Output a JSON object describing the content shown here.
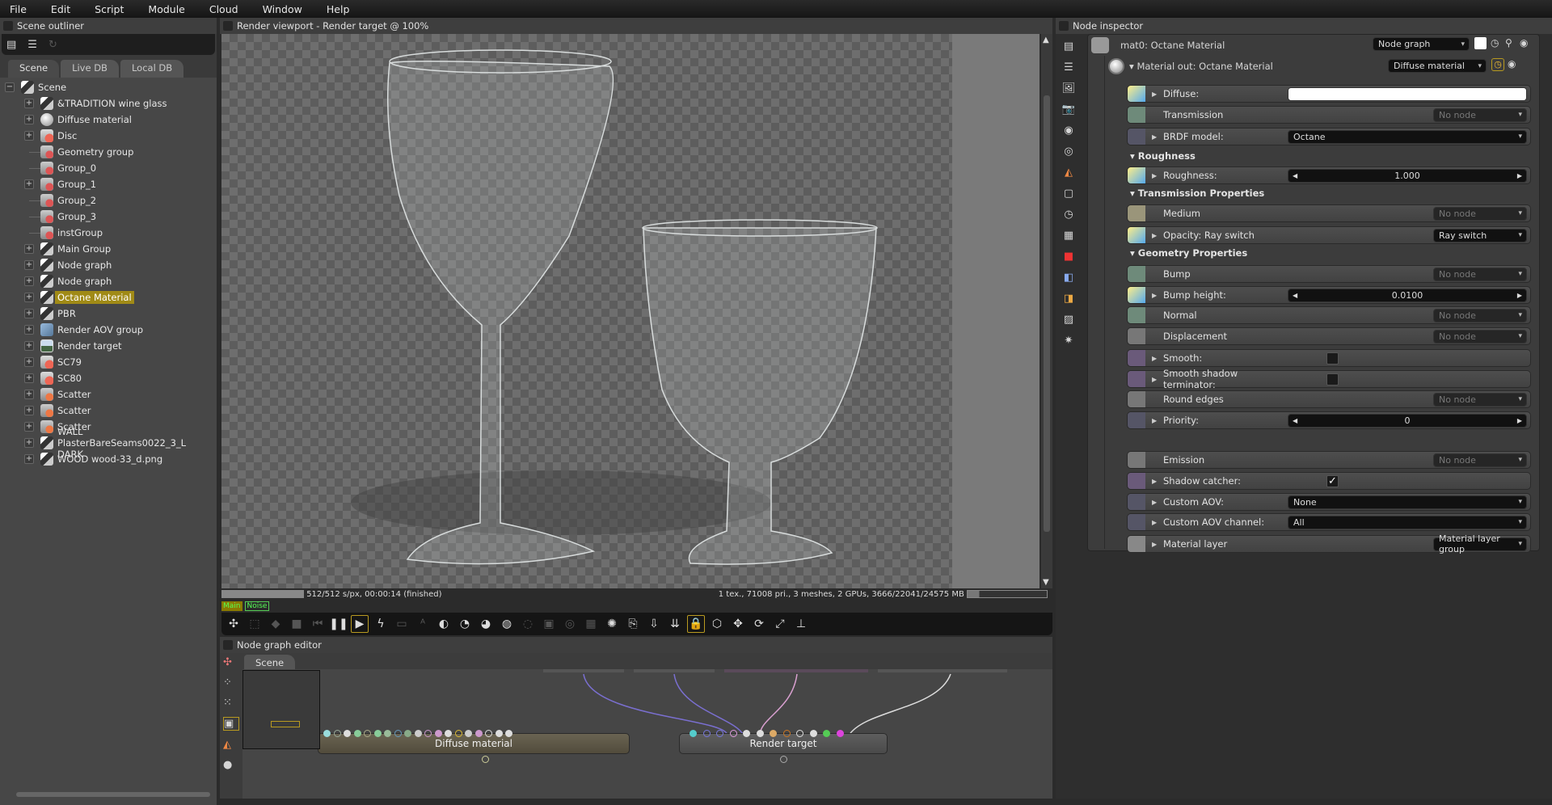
{
  "menu": [
    "File",
    "Edit",
    "Script",
    "Module",
    "Cloud",
    "Window",
    "Help"
  ],
  "outliner": {
    "title": "Scene outliner",
    "tabs": [
      "Scene",
      "Live DB",
      "Local DB"
    ],
    "root": "Scene",
    "items": [
      {
        "label": "&TRADITION wine glass",
        "icon": "node-graph-icon",
        "expandable": true
      },
      {
        "label": "Diffuse material",
        "icon": "material-sphere-icon",
        "expandable": true
      },
      {
        "label": "Disc",
        "icon": "geometry-icon",
        "expandable": true
      },
      {
        "label": "Geometry group",
        "icon": "geometry-group-icon",
        "expandable": false
      },
      {
        "label": "Group_0",
        "icon": "geometry-group-icon",
        "expandable": false
      },
      {
        "label": "Group_1",
        "icon": "geometry-group-icon",
        "expandable": true
      },
      {
        "label": "Group_2",
        "icon": "geometry-group-icon",
        "expandable": false
      },
      {
        "label": "Group_3",
        "icon": "geometry-group-icon",
        "expandable": false
      },
      {
        "label": "instGroup",
        "icon": "geometry-group-icon",
        "expandable": false
      },
      {
        "label": "Main Group",
        "icon": "node-graph-icon",
        "expandable": true
      },
      {
        "label": "Node graph",
        "icon": "node-graph-icon",
        "expandable": true
      },
      {
        "label": "Node graph",
        "icon": "node-graph-icon",
        "expandable": true
      },
      {
        "label": "Octane Material",
        "icon": "node-graph-icon",
        "expandable": true,
        "selected": true
      },
      {
        "label": "PBR",
        "icon": "node-graph-icon",
        "expandable": true
      },
      {
        "label": "Render AOV group",
        "icon": "aov-group-icon",
        "expandable": true
      },
      {
        "label": "Render target",
        "icon": "render-target-icon",
        "expandable": true
      },
      {
        "label": "SC79",
        "icon": "geometry-icon",
        "expandable": true
      },
      {
        "label": "SC80",
        "icon": "geometry-icon",
        "expandable": true
      },
      {
        "label": "Scatter",
        "icon": "scatter-icon",
        "expandable": true
      },
      {
        "label": "Scatter",
        "icon": "scatter-icon",
        "expandable": true
      },
      {
        "label": "Scatter",
        "icon": "scatter-icon",
        "expandable": true
      },
      {
        "label": "WALL PlasterBareSeams0022_3_L DARK",
        "icon": "node-graph-icon",
        "expandable": true
      },
      {
        "label": "WOOD wood-33_d.png",
        "icon": "node-graph-icon",
        "expandable": true
      }
    ]
  },
  "viewport": {
    "title": "Render viewport - Render target @ 100%",
    "status_left": "512/512 s/px, 00:00:14 (finished)",
    "status_right": "1 tex., 71008 pri., 3 meshes, 2 GPUs, 3666/22041/24575 MB",
    "progress": 1.0,
    "memory_usage": 0.15,
    "passes": [
      "Main",
      "Noise"
    ],
    "toolbar": [
      "recenter",
      "region",
      "color-picker",
      "stop",
      "restart",
      "pause",
      "start",
      "realtime",
      "viewport-res",
      "afi",
      "color-wheel",
      "picker-mat",
      "picker-obj",
      "picker-focus",
      "picker-white",
      "picker-crop",
      "render-region",
      "film-region",
      "clay",
      "load",
      "save",
      "export",
      "lock",
      "camera",
      "move",
      "rotate",
      "fit",
      "axis"
    ]
  },
  "node_graph": {
    "title": "Node graph editor",
    "tab": "Scene",
    "nodes": [
      "Diffuse material",
      "Render target"
    ]
  },
  "inspector": {
    "title": "Node inspector",
    "header": "mat0: Octane Material",
    "header_dropdown": "Node graph",
    "material_out": "Material out: Octane Material",
    "material_out_dropdown": "Diffuse material",
    "rows": {
      "diffuse": {
        "label": "Diffuse:",
        "value": "#ffffff"
      },
      "transmission": {
        "label": "Transmission",
        "value": "No node"
      },
      "brdf": {
        "label": "BRDF model:",
        "value": "Octane"
      },
      "roughness_sec": "Roughness",
      "roughness": {
        "label": "Roughness:",
        "value": "1.000"
      },
      "trans_sec": "Transmission Properties",
      "medium": {
        "label": "Medium",
        "value": "No node"
      },
      "opacity": {
        "label": "Opacity: Ray switch",
        "value": "Ray switch"
      },
      "geo_sec": "Geometry Properties",
      "bump": {
        "label": "Bump",
        "value": "No node"
      },
      "bump_height": {
        "label": "Bump height:",
        "value": "0.0100"
      },
      "normal": {
        "label": "Normal",
        "value": "No node"
      },
      "displacement": {
        "label": "Displacement",
        "value": "No node"
      },
      "smooth": {
        "label": "Smooth:",
        "checked": false
      },
      "smooth_shadow": {
        "label": "Smooth shadow terminator:",
        "checked": false
      },
      "round_edges": {
        "label": "Round edges",
        "value": "No node"
      },
      "priority": {
        "label": "Priority:",
        "value": "0"
      },
      "emission": {
        "label": "Emission",
        "value": "No node"
      },
      "shadow_catcher": {
        "label": "Shadow catcher:",
        "checked": true,
        "mark": "✓"
      },
      "custom_aov": {
        "label": "Custom AOV:",
        "value": "None"
      },
      "custom_aov_channel": {
        "label": "Custom AOV channel:",
        "value": "All"
      },
      "material_layer": {
        "label": "Material layer",
        "value": "Material layer group"
      }
    }
  }
}
